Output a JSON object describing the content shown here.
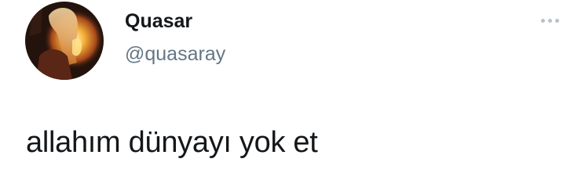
{
  "user": {
    "display_name": "Quasar",
    "handle": "@quasaray"
  },
  "tweet": {
    "text": "allahım dünyayı yok et"
  },
  "icons": {
    "avatar": "profile-photo-avatar",
    "more": "more-options-icon"
  },
  "colors": {
    "name": "#14171a",
    "handle": "#657786",
    "dots": "#b8c2cc"
  }
}
